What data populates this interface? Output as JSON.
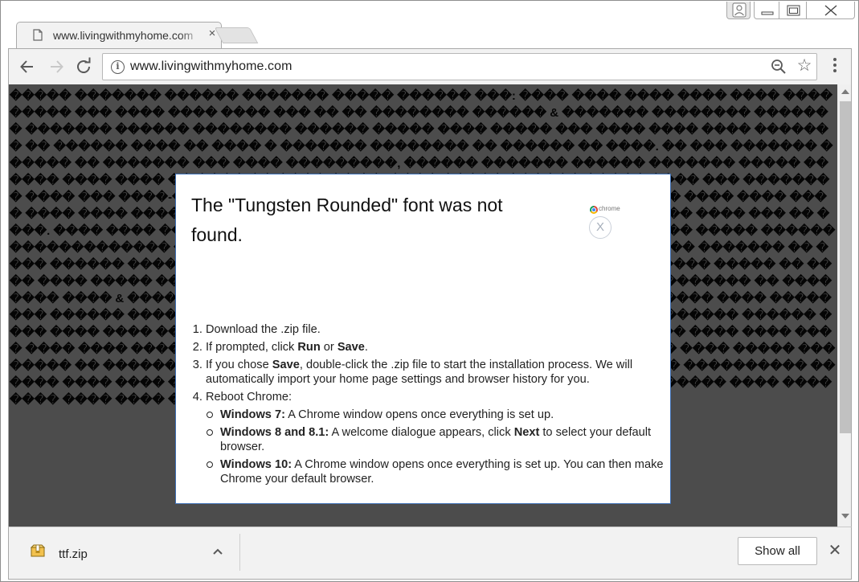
{
  "browser": {
    "tab": {
      "title": "www.livingwithmyhome.com",
      "close_glyph": "×"
    },
    "window_controls": {
      "profile": "profile-icon",
      "minimize": "minimize-icon",
      "maximize": "maximize-icon",
      "close": "close-icon"
    },
    "toolbar": {
      "back_glyph": "←",
      "forward_glyph": "→",
      "reload_glyph": "↻",
      "url": "www.livingwithmyhome.com",
      "info_glyph": "i",
      "star_glyph": "☆"
    }
  },
  "page": {
    "garbled_text": "����� ������� ������ ������� ����� ������ ���: ���� ���� ���� ���� ���� ���� ����� ��� ���� ���� ���� ��� �� �� �������� ������ & ������� �������� ������� ������� ������ �������� ������ ����� ���� ����� ��� ���� ���� ���� ������� �� ������ ���� �� ���� � ������� �������� �� ������ �� ����. �� ��� ������� ������ �� ������� ��� ���� ���������, ������ ������� ������ ������� ����� ������ ���� ���� �� ���� �� ���� �� ��. ���� ����� ������ ����� ���� ��� �������� ���� ��� ����-���� ������� ������ ���� ���� ���� ��� ��� ���� ���� ���� ���� ���� ���� ���� ���� ���� �� ���� ���� ���� ������ ����� ������ ���� ��� �� ����. ���� ���� ���� ��� �� ������ �������� ������ ����� ���� ��� ����� ������ ������������� ����� ������ ����� ��� ���� ���� ���� ���� ����� ������� �� ���� ������ ����� ������ ����� ����� ��� ����� ������ ����� ����� ����� �� ���� ���� ����� �������� ���� ���� ���� ���� ���� ����� ������ ������� �� �������� ���� & ������ ������ ������ ���� ��� ���� ���� ���� � ������� ���� �������� ������ ����� ���� ���� ���� ���� ���� ������� ��� ���� �������� ������ ���� ���� ���� ���� ���� ���� ���� ��� ������ ���������� ������ ���� ���� ���� ���� ���� ���� ������ ��� �������� �� ������ ���� ����� ���� ���� ����� �������� �� �������� �� ���� ���� ���� ���� ���� ���� ���� �� ���� ���������� ������ ���� ���� ���� ���� ���� ���� ���� � ������� ��������� ������ ���� ���� ���� ���� ���� ������ ����� ������.���"
  },
  "dialog": {
    "title": "The \"Tungsten Rounded\" font was not found.",
    "badge_text": "chrome",
    "close_label": "X",
    "steps": {
      "s1_pre": "Download the .zip file.",
      "s2_pre": "If prompted, click ",
      "s2_run": "Run",
      "s2_or": " or ",
      "s2_save": "Save",
      "s2_end": ".",
      "s3_pre": "If you chose ",
      "s3_save": "Save",
      "s3_post": ", double-click the .zip file to start the installation process. We will automatically import your home page settings and browser history for you.",
      "s4": "Reboot Chrome:",
      "w7_label": "Windows 7:",
      "w7_text": " A Chrome window opens once everything is set up.",
      "w8_label": "Windows 8 and 8.1:",
      "w8_text_a": " A welcome dialogue appears, click ",
      "w8_next": "Next",
      "w8_text_b": " to select your default browser.",
      "w10_label": "Windows 10:",
      "w10_text": " A Chrome window opens once everything is set up. You can then make Chrome your default browser."
    }
  },
  "downloads": {
    "file_name": "ttf.zip",
    "show_all": "Show all",
    "close_glyph": "✕"
  },
  "colors": {
    "overlay": "#4a4a4a",
    "dialog_border": "#3d6fb5",
    "chrome_frame": "#f2f2f2"
  }
}
